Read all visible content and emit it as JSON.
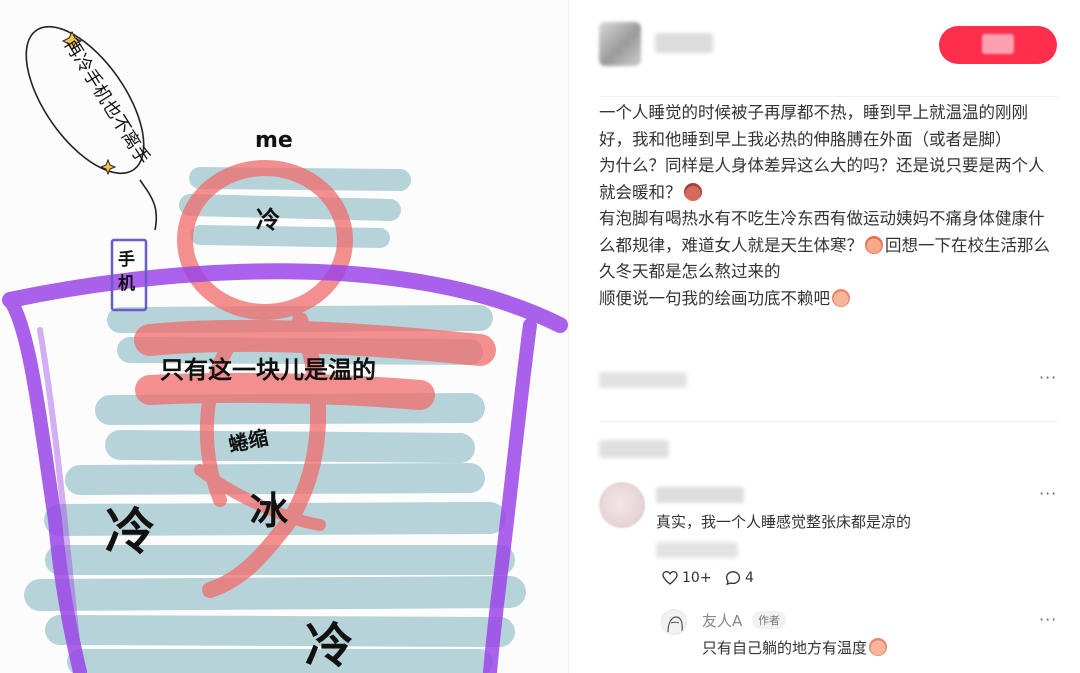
{
  "drawing": {
    "bubble_text": "再冷手机也不离手",
    "me_label": "me",
    "cold_small": "冷",
    "phone_label": "手机",
    "warm_spot": "只有这一块儿是温的",
    "curled": "蜷缩",
    "ice": "冰",
    "cold_left": "冷",
    "cold_bottom": "冷",
    "colors": {
      "purple": "#9b45e8",
      "pink": "#f06b6b",
      "teal": "#a9cdd3"
    }
  },
  "header": {
    "follow_button": "",
    "accent": "#ff2e4d"
  },
  "post": {
    "lines": [
      "一个人睡觉的时候被子再厚都不热，睡到早上就温温的刚刚好，我和他睡到早上我必热的伸胳膊在外面（或者是脚）",
      "为什么？同样是人身体差异这么大的吗？还是说只要是两个人就会暖和？",
      "有泡脚有喝热水有不吃生冷东西有做运动姨妈不痛身体健康什么都规律，难道女人就是天生体寒？",
      "回想一下在校生活那么久冬天都是怎么熬过来的",
      "顺便说一句我的绘画功底不赖吧"
    ],
    "more": "···"
  },
  "comments": {
    "c1": {
      "text": "真实，我一个人睡感觉整张床都是凉的",
      "likes": "10+",
      "replies": "4",
      "more": "···"
    },
    "c2": {
      "name": "友人A",
      "badge": "作者",
      "text": "只有自己躺的地方有温度",
      "more": "···"
    }
  }
}
